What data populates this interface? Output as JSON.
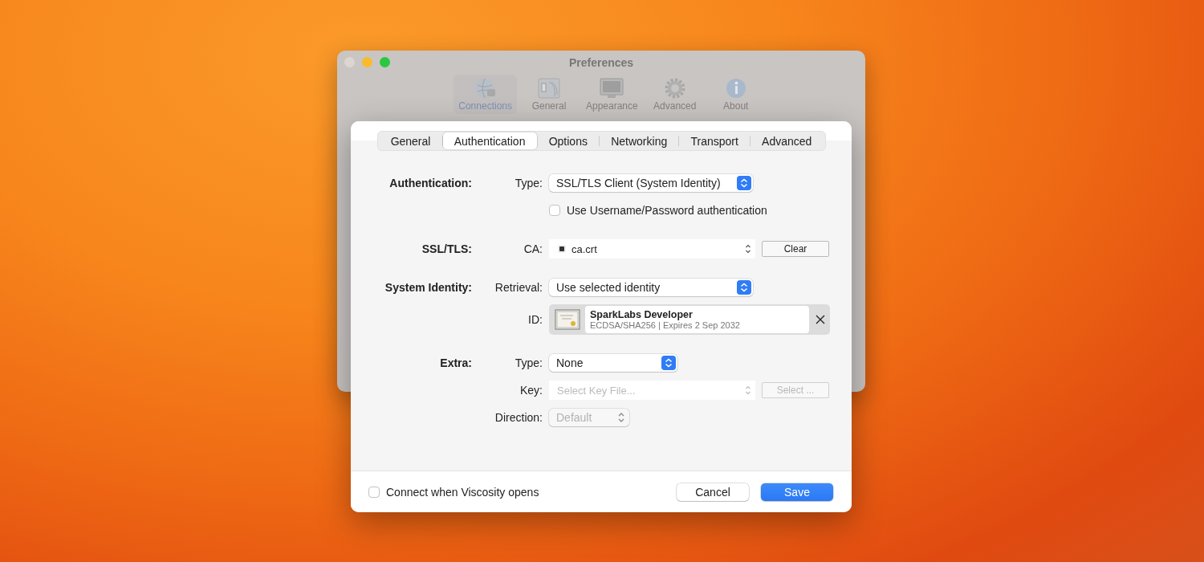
{
  "window": {
    "title": "Preferences",
    "toolbar": [
      {
        "label": "Connections",
        "kind": "globe",
        "selected": true
      },
      {
        "label": "General",
        "kind": "panel",
        "selected": false
      },
      {
        "label": "Appearance",
        "kind": "monitor",
        "selected": false
      },
      {
        "label": "Advanced",
        "kind": "gear",
        "selected": false
      },
      {
        "label": "About",
        "kind": "info",
        "selected": false
      }
    ]
  },
  "sheet": {
    "tabs": [
      {
        "label": "General",
        "selected": false
      },
      {
        "label": "Authentication",
        "selected": true
      },
      {
        "label": "Options",
        "selected": false
      },
      {
        "label": "Networking",
        "selected": false
      },
      {
        "label": "Transport",
        "selected": false
      },
      {
        "label": "Advanced",
        "selected": false
      }
    ],
    "sections": [
      {
        "heading": "Authentication:",
        "rows": [
          {
            "kind": "popup",
            "label": "Type:",
            "value": "SSL/TLS Client (System Identity)",
            "disabled": false
          },
          {
            "kind": "checkbox",
            "label": "Use Username/Password authentication",
            "checked": false
          }
        ]
      },
      {
        "heading": "SSL/TLS:",
        "rows": [
          {
            "kind": "file",
            "label": "CA:",
            "value": "ca.crt",
            "button": "Clear",
            "disabled": false
          }
        ]
      },
      {
        "heading": "System Identity:",
        "rows": [
          {
            "kind": "popup",
            "label": "Retrieval:",
            "value": "Use selected identity",
            "disabled": false
          },
          {
            "kind": "identity",
            "label": "ID:",
            "name": "SparkLabs Developer",
            "detail": "ECDSA/SHA256 | Expires 2 Sep 2032"
          }
        ]
      },
      {
        "heading": "Extra:",
        "rows": [
          {
            "kind": "popup",
            "label": "Type:",
            "value": "None",
            "disabled": false
          },
          {
            "kind": "file",
            "label": "Key:",
            "placeholder": "Select Key File...",
            "button": "Select ...",
            "disabled": true
          },
          {
            "kind": "popup",
            "label": "Direction:",
            "value": "Default",
            "disabled": true
          }
        ]
      }
    ],
    "footer": {
      "checkbox": {
        "label": "Connect when Viscosity opens",
        "checked": false
      },
      "buttons": [
        {
          "label": "Cancel",
          "kind": "default"
        },
        {
          "label": "Save",
          "kind": "primary"
        }
      ]
    }
  }
}
